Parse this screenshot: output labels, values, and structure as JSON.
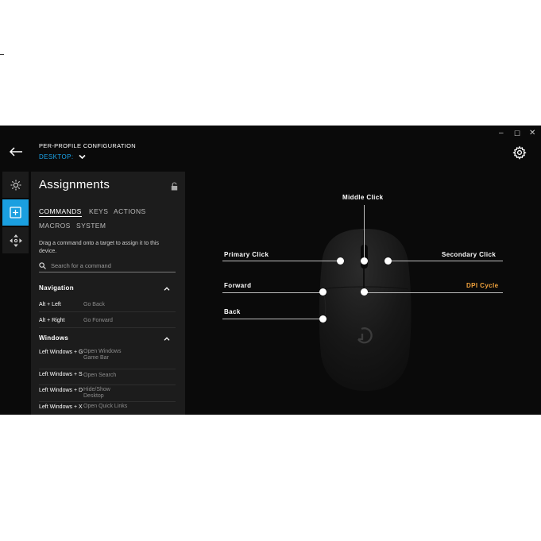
{
  "window": {
    "minimize_glyph": "–",
    "maximize_glyph": "☐",
    "close_glyph": "✕"
  },
  "header": {
    "config_label": "PER-PROFILE CONFIGURATION",
    "profile_name": "DESKTOP:"
  },
  "panel": {
    "title": "Assignments",
    "tabs": [
      {
        "label": "COMMANDS",
        "active": true
      },
      {
        "label": "KEYS",
        "active": false
      },
      {
        "label": "ACTIONS",
        "active": false
      },
      {
        "label": "MACROS",
        "active": false
      },
      {
        "label": "SYSTEM",
        "active": false
      }
    ],
    "hint": "Drag a command onto a target to assign it to this device.",
    "search_placeholder": "Search for a command",
    "sections": [
      {
        "title": "Navigation",
        "rows": [
          {
            "key": "Alt + Left",
            "action": "Go Back"
          },
          {
            "key": "Alt + Right",
            "action": "Go Forward"
          }
        ]
      },
      {
        "title": "Windows",
        "rows": [
          {
            "key": "Left Windows + G",
            "action": "Open Windows Game Bar"
          },
          {
            "key": "Left Windows + S",
            "action": "Open Search"
          },
          {
            "key": "Left Windows + D",
            "action": "Hide/Show Desktop"
          },
          {
            "key": "Left Windows + X",
            "action": "Open Quick Links"
          }
        ]
      }
    ]
  },
  "device": {
    "buttons": {
      "middle_click": "Middle Click",
      "primary_click": "Primary Click",
      "secondary_click": "Secondary Click",
      "forward": "Forward",
      "dpi_cycle": "DPI Cycle",
      "back": "Back"
    },
    "colors": {
      "accent_blue": "#1a9fe0",
      "dpi_orange": "#f0a23c"
    }
  }
}
